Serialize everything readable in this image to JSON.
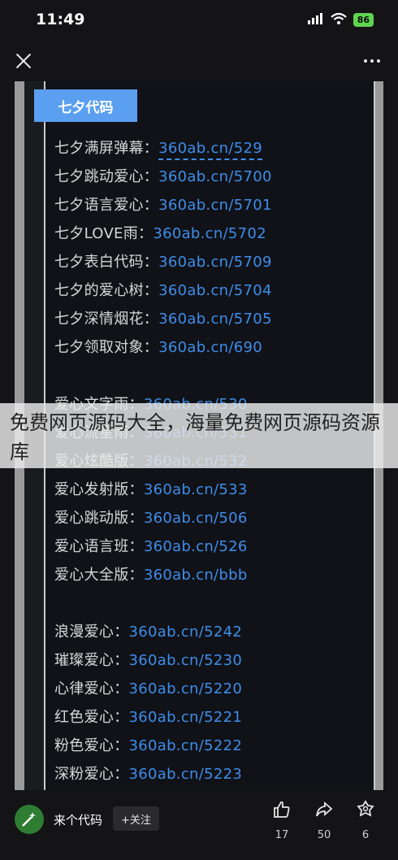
{
  "status_bar": {
    "time": "11:49",
    "battery": "86"
  },
  "header": {
    "title": "七夕代码"
  },
  "code_lines": [
    {
      "label": "七夕满屏弹幕：",
      "url": "360ab.cn/529"
    },
    {
      "label": "七夕跳动爱心：",
      "url": "360ab.cn/5700"
    },
    {
      "label": "七夕语言爱心：",
      "url": "360ab.cn/5701"
    },
    {
      "label": "七夕LOVE雨：",
      "url": "360ab.cn/5702"
    },
    {
      "label": "七夕表白代码：",
      "url": "360ab.cn/5709"
    },
    {
      "label": "七夕的爱心树：",
      "url": "360ab.cn/5704"
    },
    {
      "label": "七夕深情烟花：",
      "url": "360ab.cn/5705"
    },
    {
      "label": "七夕领取对象：",
      "url": "360ab.cn/690"
    },
    {
      "label": "爱心文字雨：",
      "url": "360ab.cn/530"
    },
    {
      "label": "爱心流星雨：",
      "url": "360ab.cn/531"
    },
    {
      "label": "爱心炫酷版：",
      "url": "360ab.cn/532"
    },
    {
      "label": "爱心发射版：",
      "url": "360ab.cn/533"
    },
    {
      "label": "爱心跳动版：",
      "url": "360ab.cn/506"
    },
    {
      "label": "爱心语言班：",
      "url": "360ab.cn/526"
    },
    {
      "label": "爱心大全版：",
      "url": "360ab.cn/bbb"
    },
    {
      "label": "浪漫爱心：",
      "url": "360ab.cn/5242"
    },
    {
      "label": "璀璨爱心：",
      "url": "360ab.cn/5230"
    },
    {
      "label": "心律爱心：",
      "url": "360ab.cn/5220"
    },
    {
      "label": "红色爱心：",
      "url": "360ab.cn/5221"
    },
    {
      "label": "粉色爱心：",
      "url": "360ab.cn/5222"
    },
    {
      "label": "深粉爱心：",
      "url": "360ab.cn/5223"
    }
  ],
  "watermark": {
    "text": "免费网页源码大全，海量免费网页源码资源库"
  },
  "footer": {
    "author": "来个代码",
    "follow_label": "+关注",
    "like_count": "17",
    "share_count": "50",
    "collect_count": "6"
  },
  "colors": {
    "accent": "#3f8de8",
    "header_bg": "#5a9ff0"
  },
  "icons": [
    "close-icon",
    "more-icon",
    "wifi-icon",
    "signal-icon",
    "like-icon",
    "share-icon",
    "collect-icon"
  ]
}
